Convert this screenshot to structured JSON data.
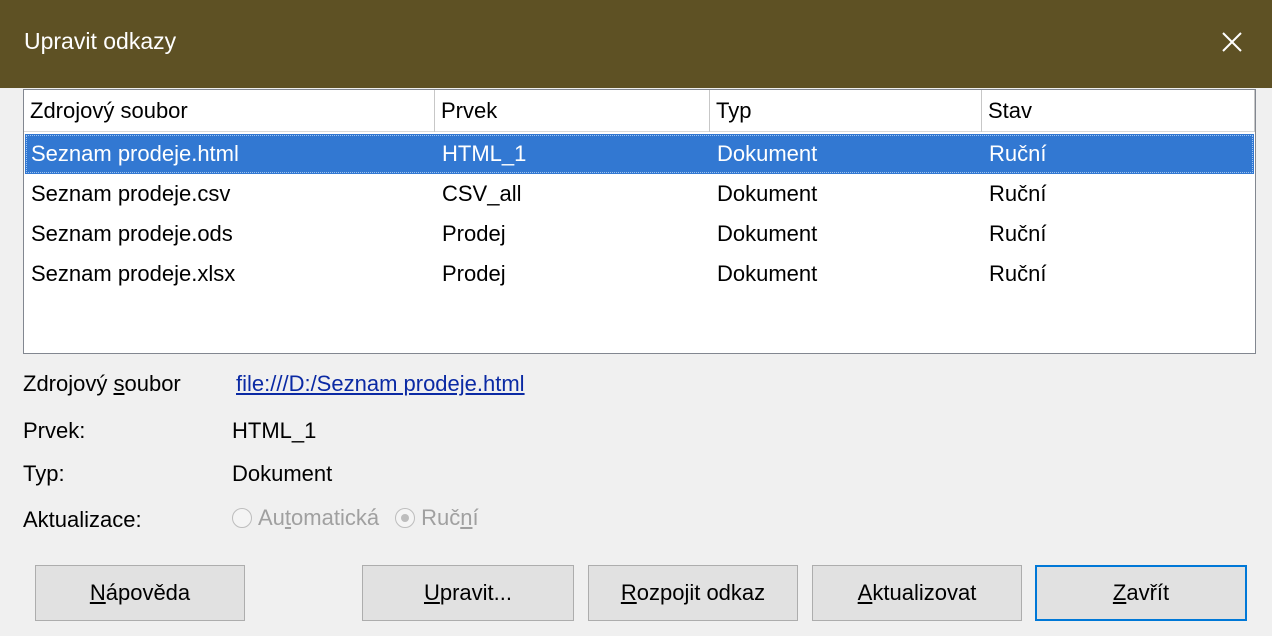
{
  "dialog": {
    "title": "Upravit odkazy",
    "close_symbol": "✕"
  },
  "table": {
    "headers": [
      "Zdrojový soubor",
      "Prvek",
      "Typ",
      "Stav"
    ],
    "rows": [
      [
        "Seznam prodeje.html",
        "HTML_1",
        "Dokument",
        "Ruční"
      ],
      [
        "Seznam prodeje.csv",
        "CSV_all",
        "Dokument",
        "Ruční"
      ],
      [
        "Seznam prodeje.ods",
        "Prodej",
        "Dokument",
        "Ruční"
      ],
      [
        "Seznam prodeje.xlsx",
        "Prodej",
        "Dokument",
        "Ruční"
      ]
    ],
    "selected_row": 0
  },
  "details": {
    "source_label_pre": "Zdrojový ",
    "source_label_u": "s",
    "source_label_post": "oubor",
    "source_value": "file:///D:/Seznam prodeje.html",
    "element_label": "Prvek:",
    "element_value": "HTML_1",
    "type_label": "Typ:",
    "type_value": "Dokument",
    "update_label": "Aktualizace:",
    "update_options": [
      {
        "pre": "Au",
        "u": "t",
        "post": "omatická",
        "checked": false,
        "enabled": false
      },
      {
        "pre": "Ruč",
        "u": "n",
        "post": "í",
        "checked": true,
        "enabled": false
      }
    ]
  },
  "buttons": {
    "help": {
      "pre": "",
      "u": "N",
      "post": "ápověda"
    },
    "edit": {
      "pre": "",
      "u": "U",
      "post": "pravit..."
    },
    "unlink": {
      "pre": "",
      "u": "R",
      "post": "ozpojit odkaz"
    },
    "update": {
      "pre": "",
      "u": "A",
      "post": "ktualizovat"
    },
    "close": {
      "pre": "",
      "u": "Z",
      "post": "avřít"
    }
  },
  "colors": {
    "titlebar": "#5e5124",
    "selection": "#3278d2",
    "link": "#0b2aa4",
    "default_button_border": "#0078d7"
  }
}
